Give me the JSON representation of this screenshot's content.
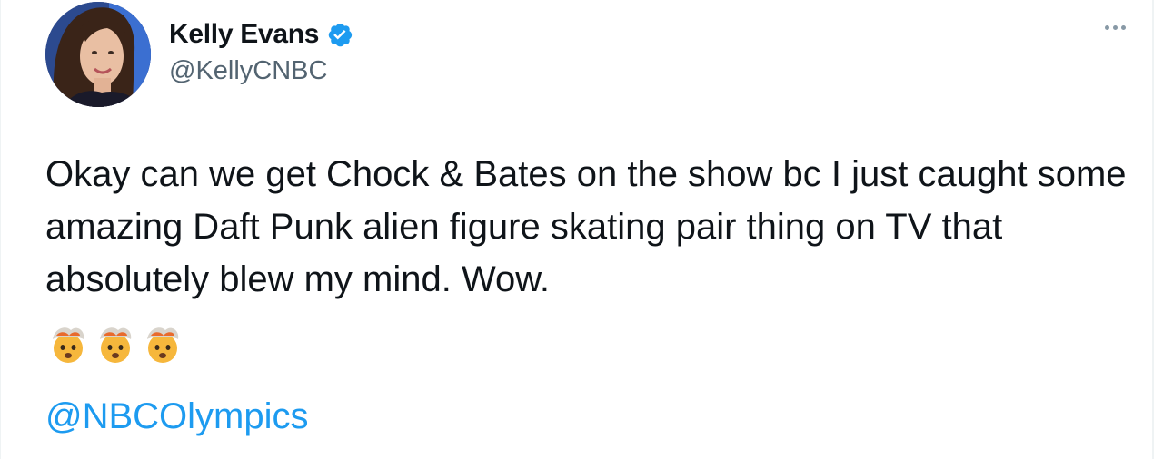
{
  "tweet": {
    "author": {
      "display_name": "Kelly Evans",
      "handle": "@KellyCNBC",
      "verified": true
    },
    "text": "Okay can we get Chock & Bates on the show bc I just caught some amazing Daft Punk alien figure skating pair thing on TV that absolutely blew my mind. Wow.",
    "emojis": [
      "exploding-head-emoji",
      "exploding-head-emoji",
      "exploding-head-emoji"
    ],
    "mention": "@NBCOlympics",
    "colors": {
      "text": "#0f1419",
      "secondary": "#536471",
      "link": "#1d9bf0",
      "verified": "#1d9bf0"
    }
  },
  "icons": {
    "more": "more-horizontal-icon",
    "verified": "verified-badge-icon"
  }
}
